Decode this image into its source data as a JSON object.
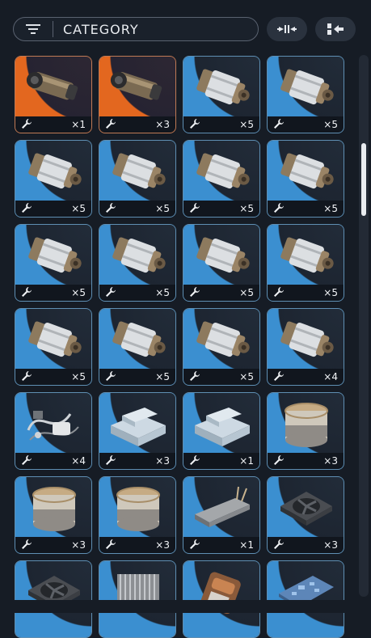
{
  "header": {
    "category_label": "CATEGORY",
    "filter_icon": "filter-lines-icon",
    "compress_icon": "arrows-inward-icon",
    "collapse_icon": "collapse-left-icon"
  },
  "colors": {
    "rare_orange": "#e3671f",
    "common_blue": "#3b8fd0",
    "panel": "#161c25"
  },
  "items": [
    {
      "icon": "blaster-icon",
      "rarity": "orange",
      "qty": "×1"
    },
    {
      "icon": "blaster-icon",
      "rarity": "orange",
      "qty": "×3"
    },
    {
      "icon": "canister-icon",
      "rarity": "blue",
      "qty": "×5"
    },
    {
      "icon": "canister-icon",
      "rarity": "blue",
      "qty": "×5"
    },
    {
      "icon": "canister-icon",
      "rarity": "blue",
      "qty": "×5"
    },
    {
      "icon": "canister-icon",
      "rarity": "blue",
      "qty": "×5"
    },
    {
      "icon": "canister-icon",
      "rarity": "blue",
      "qty": "×5"
    },
    {
      "icon": "canister-icon",
      "rarity": "blue",
      "qty": "×5"
    },
    {
      "icon": "canister-icon",
      "rarity": "blue",
      "qty": "×5"
    },
    {
      "icon": "canister-icon",
      "rarity": "blue",
      "qty": "×5"
    },
    {
      "icon": "canister-icon",
      "rarity": "blue",
      "qty": "×5"
    },
    {
      "icon": "canister-icon",
      "rarity": "blue",
      "qty": "×5"
    },
    {
      "icon": "canister-icon",
      "rarity": "blue",
      "qty": "×5"
    },
    {
      "icon": "canister-icon",
      "rarity": "blue",
      "qty": "×5"
    },
    {
      "icon": "canister-icon",
      "rarity": "blue",
      "qty": "×5"
    },
    {
      "icon": "canister-icon",
      "rarity": "blue",
      "qty": "×4"
    },
    {
      "icon": "wires-scrap-icon",
      "rarity": "blue",
      "qty": "×4"
    },
    {
      "icon": "metal-block-icon",
      "rarity": "blue",
      "qty": "×3"
    },
    {
      "icon": "metal-block-icon",
      "rarity": "blue",
      "qty": "×1"
    },
    {
      "icon": "drum-icon",
      "rarity": "blue",
      "qty": "×3"
    },
    {
      "icon": "drum-icon",
      "rarity": "blue",
      "qty": "×3"
    },
    {
      "icon": "drum-icon",
      "rarity": "blue",
      "qty": "×3"
    },
    {
      "icon": "battery-pack-icon",
      "rarity": "blue",
      "qty": "×1"
    },
    {
      "icon": "fan-unit-icon",
      "rarity": "blue",
      "qty": "×3"
    },
    {
      "icon": "fan-unit-icon",
      "rarity": "blue",
      "qty": ""
    },
    {
      "icon": "heatsink-icon",
      "rarity": "blue",
      "qty": ""
    },
    {
      "icon": "copper-part-icon",
      "rarity": "blue",
      "qty": ""
    },
    {
      "icon": "circuit-board-icon",
      "rarity": "blue",
      "qty": ""
    }
  ]
}
